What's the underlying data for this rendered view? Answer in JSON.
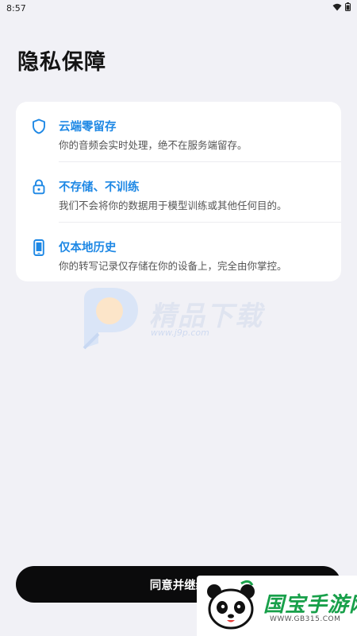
{
  "status_bar": {
    "time": "8:57",
    "icons": [
      "wifi-icon",
      "battery-icon"
    ]
  },
  "page": {
    "title": "隐私保障"
  },
  "items": [
    {
      "icon": "shield-icon",
      "title": "云端零留存",
      "description": "你的音频会实时处理，绝不在服务端留存。"
    },
    {
      "icon": "lock-icon",
      "title": "不存储、不训练",
      "description": "我们不会将你的数据用于模型训练或其他任何目的。"
    },
    {
      "icon": "phone-icon",
      "title": "仅本地历史",
      "description": "你的转写记录仅存储在你的设备上，完全由你掌控。"
    }
  ],
  "actions": {
    "continue_label": "同意并继续"
  },
  "watermarks": {
    "top_text": "精品下载",
    "top_url": "www.j9p.com",
    "bottom_text": "国宝手游网",
    "bottom_url": "WWW.GB315.COM"
  },
  "colors": {
    "accent": "#1e88e5",
    "background": "#f1f1f6",
    "card": "#ffffff",
    "button": "#0b0b0c"
  }
}
